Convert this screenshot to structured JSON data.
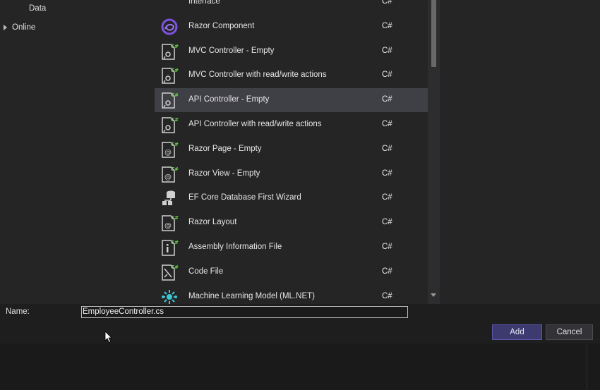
{
  "tree": {
    "items": [
      {
        "label": "Data",
        "expandable": false
      },
      {
        "label": "Online",
        "expandable": true
      }
    ]
  },
  "templates": [
    {
      "name": "Interface",
      "lang": "C#",
      "icon": "interface-icon",
      "selected": false
    },
    {
      "name": "Razor Component",
      "lang": "C#",
      "icon": "razor-component-icon",
      "selected": false
    },
    {
      "name": "MVC Controller - Empty",
      "lang": "C#",
      "icon": "controller-icon",
      "selected": false
    },
    {
      "name": "MVC Controller with read/write actions",
      "lang": "C#",
      "icon": "controller-icon",
      "selected": false
    },
    {
      "name": "API Controller - Empty",
      "lang": "C#",
      "icon": "controller-icon",
      "selected": true
    },
    {
      "name": "API Controller with read/write actions",
      "lang": "C#",
      "icon": "controller-icon",
      "selected": false
    },
    {
      "name": "Razor Page - Empty",
      "lang": "C#",
      "icon": "razor-page-icon",
      "selected": false
    },
    {
      "name": "Razor View - Empty",
      "lang": "C#",
      "icon": "razor-page-icon",
      "selected": false
    },
    {
      "name": "EF Core Database First Wizard",
      "lang": "C#",
      "icon": "database-icon",
      "selected": false
    },
    {
      "name": "Razor Layout",
      "lang": "C#",
      "icon": "razor-page-icon",
      "selected": false
    },
    {
      "name": "Assembly Information File",
      "lang": "C#",
      "icon": "info-file-icon",
      "selected": false
    },
    {
      "name": "Code File",
      "lang": "C#",
      "icon": "code-file-icon",
      "selected": false
    },
    {
      "name": "Machine Learning Model (ML.NET)",
      "lang": "C#",
      "icon": "ml-model-icon",
      "selected": false
    }
  ],
  "form": {
    "name_label": "Name:",
    "name_value": "EmployeeController.cs"
  },
  "buttons": {
    "add_label": "Add",
    "cancel_label": "Cancel"
  },
  "colors": {
    "selected_row": "#3f3f46",
    "add_button": "#3c3a6e",
    "csharp_badge": "#6fcf52"
  }
}
